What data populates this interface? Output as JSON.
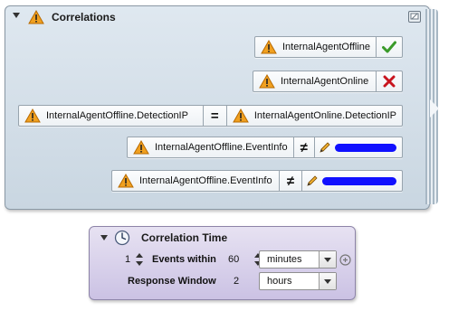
{
  "correlations": {
    "title": "Correlations",
    "rows": [
      {
        "left": "InternalAgentOffline",
        "status": "check-icon"
      },
      {
        "left": "InternalAgentOnline",
        "status": "x-icon"
      },
      {
        "left": "InternalAgentOffline.DetectionIP",
        "operator": "=",
        "right": "InternalAgentOnline.DetectionIP"
      },
      {
        "left": "InternalAgentOffline.EventInfo",
        "operator": "≠",
        "right_redacted": true
      },
      {
        "left": "InternalAgentOffline.EventInfo",
        "operator": "≠",
        "right_redacted": true
      }
    ],
    "colors": {
      "panel": "#c9d6e1",
      "warning": "#f0a020",
      "check": "#3a9a2a",
      "cross": "#c8141e",
      "redaction": "#1010ff"
    }
  },
  "correlation_time": {
    "title": "Correlation Time",
    "events_count": "1",
    "events_label": "Events within",
    "window_value": "60",
    "window_unit": "minutes",
    "response_label": "Response Window",
    "response_value": "2",
    "response_unit": "hours",
    "colors": {
      "panel": "#d6cfea"
    }
  }
}
